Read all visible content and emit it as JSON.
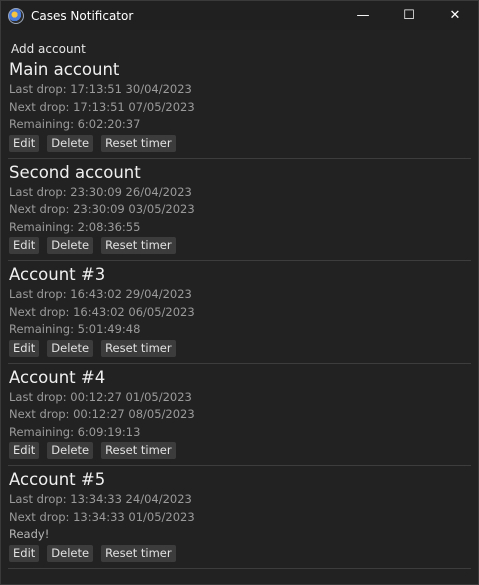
{
  "window": {
    "title": "Cases Notificator",
    "minimize_glyph": "—",
    "maximize_glyph": "☐",
    "close_glyph": "✕"
  },
  "toolbar": {
    "add_account_label": "Add account"
  },
  "labels": {
    "edit": "Edit",
    "delete": "Delete",
    "reset_timer": "Reset timer"
  },
  "accounts": [
    {
      "name": "Main account",
      "last_drop": "Last drop: 17:13:51 30/04/2023",
      "next_drop": "Next drop: 17:13:51 07/05/2023",
      "remaining": "Remaining: 6:02:20:37"
    },
    {
      "name": "Second account",
      "last_drop": "Last drop: 23:30:09 26/04/2023",
      "next_drop": "Next drop: 23:30:09 03/05/2023",
      "remaining": "Remaining: 2:08:36:55"
    },
    {
      "name": "Account #3",
      "last_drop": "Last drop: 16:43:02 29/04/2023",
      "next_drop": "Next drop: 16:43:02 06/05/2023",
      "remaining": "Remaining: 5:01:49:48"
    },
    {
      "name": "Account #4",
      "last_drop": "Last drop: 00:12:27 01/05/2023",
      "next_drop": "Next drop: 00:12:27 08/05/2023",
      "remaining": "Remaining: 6:09:19:13"
    },
    {
      "name": "Account #5",
      "last_drop": "Last drop: 13:34:33 24/04/2023",
      "next_drop": "Next drop: 13:34:33 01/05/2023",
      "remaining": "Ready!"
    }
  ]
}
